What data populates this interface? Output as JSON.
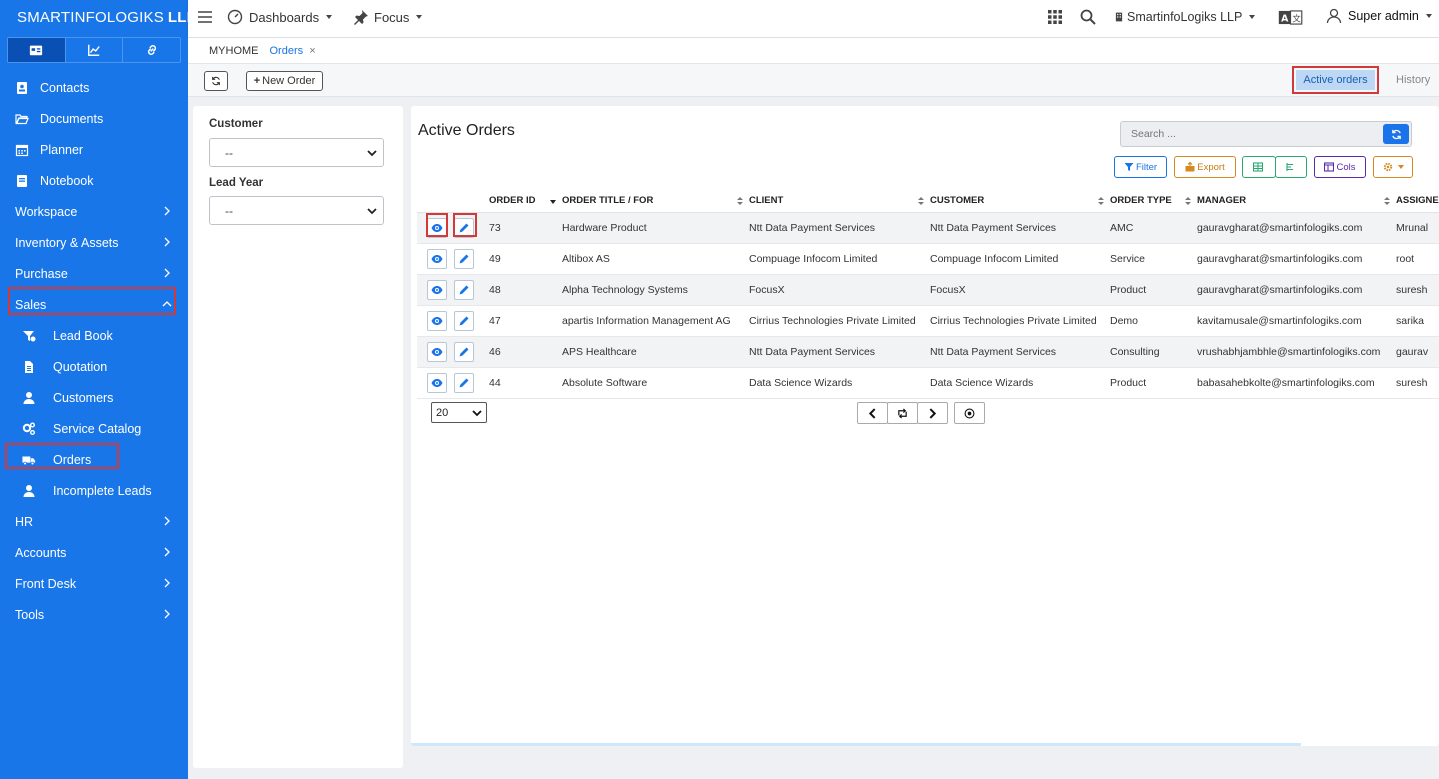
{
  "brand": {
    "name": "SMARTINFOLOGIKS",
    "suffix": "LLP"
  },
  "sidebar": {
    "tabs": [
      "calendar-card-icon",
      "chart-icon",
      "link-icon"
    ],
    "items": [
      {
        "label": "Contacts",
        "icon": "contact-card-icon"
      },
      {
        "label": "Documents",
        "icon": "folder-open-icon"
      },
      {
        "label": "Planner",
        "icon": "calendar-icon"
      },
      {
        "label": "Notebook",
        "icon": "notebook-icon"
      },
      {
        "label": "Workspace",
        "expandable": true
      },
      {
        "label": "Inventory & Assets",
        "expandable": true
      },
      {
        "label": "Purchase",
        "expandable": true
      },
      {
        "label": "Sales",
        "expanded": true
      },
      {
        "label": "Lead Book",
        "icon": "funnel-icon"
      },
      {
        "label": "Quotation",
        "icon": "file-icon"
      },
      {
        "label": "Customers",
        "icon": "user-icon"
      },
      {
        "label": "Service Catalog",
        "icon": "cogs-icon"
      },
      {
        "label": "Orders",
        "icon": "truck-icon"
      },
      {
        "label": "Incomplete Leads",
        "icon": "user-icon"
      },
      {
        "label": "HR",
        "expandable": true
      },
      {
        "label": "Accounts",
        "expandable": true
      },
      {
        "label": "Front Desk",
        "expandable": true
      },
      {
        "label": "Tools",
        "expandable": true
      }
    ]
  },
  "topbar": {
    "dashboards": "Dashboards",
    "focus": "Focus",
    "company": "SmartinfoLogiks LLP",
    "user": "Super admin"
  },
  "breadcrumb": {
    "home": "MYHOME",
    "current": "Orders",
    "close": "×"
  },
  "toolbar": {
    "new_order": "New Order",
    "active_orders": "Active orders",
    "history": "History"
  },
  "filters": {
    "customer_label": "Customer",
    "customer_value": "--",
    "lead_year_label": "Lead Year",
    "lead_year_value": "--"
  },
  "main": {
    "title": "Active Orders",
    "search_placeholder": "Search ...",
    "buttons": {
      "filter": "Filter",
      "export": "Export",
      "cols": "Cols"
    }
  },
  "table": {
    "columns": [
      "ORDER ID",
      "ORDER TITLE / FOR",
      "CLIENT",
      "CUSTOMER",
      "ORDER TYPE",
      "MANAGER",
      "ASSIGNED"
    ],
    "rows": [
      [
        "73",
        "Hardware Product",
        "Ntt Data Payment Services",
        "Ntt Data Payment Services",
        "AMC",
        "gauravgharat@smartinfologiks.com",
        "Mrunal"
      ],
      [
        "49",
        "Altibox AS",
        "Compuage Infocom Limited",
        "Compuage Infocom Limited",
        "Service",
        "gauravgharat@smartinfologiks.com",
        "root"
      ],
      [
        "48",
        "Alpha Technology Systems",
        "FocusX",
        "FocusX",
        "Product",
        "gauravgharat@smartinfologiks.com",
        "suresh"
      ],
      [
        "47",
        "apartis Information Management AG",
        "Cirrius Technologies Private Limited",
        "Cirrius Technologies Private Limited",
        "Demo",
        "kavitamusale@smartinfologiks.com",
        "sarika"
      ],
      [
        "46",
        "APS Healthcare",
        "Ntt Data Payment Services",
        "Ntt Data Payment Services",
        "Consulting",
        "vrushabhjambhle@smartinfologiks.com",
        "gaurav"
      ],
      [
        "44",
        "Absolute Software",
        "Data Science Wizards",
        "Data Science Wizards",
        "Product",
        "babasahebkolte@smartinfologiks.com",
        "suresh"
      ]
    ]
  },
  "pagination": {
    "page_size": "20"
  },
  "colors": {
    "sidebar": "#1976e8",
    "accent": "#1a73e8",
    "highlight": "#d23a3a"
  }
}
